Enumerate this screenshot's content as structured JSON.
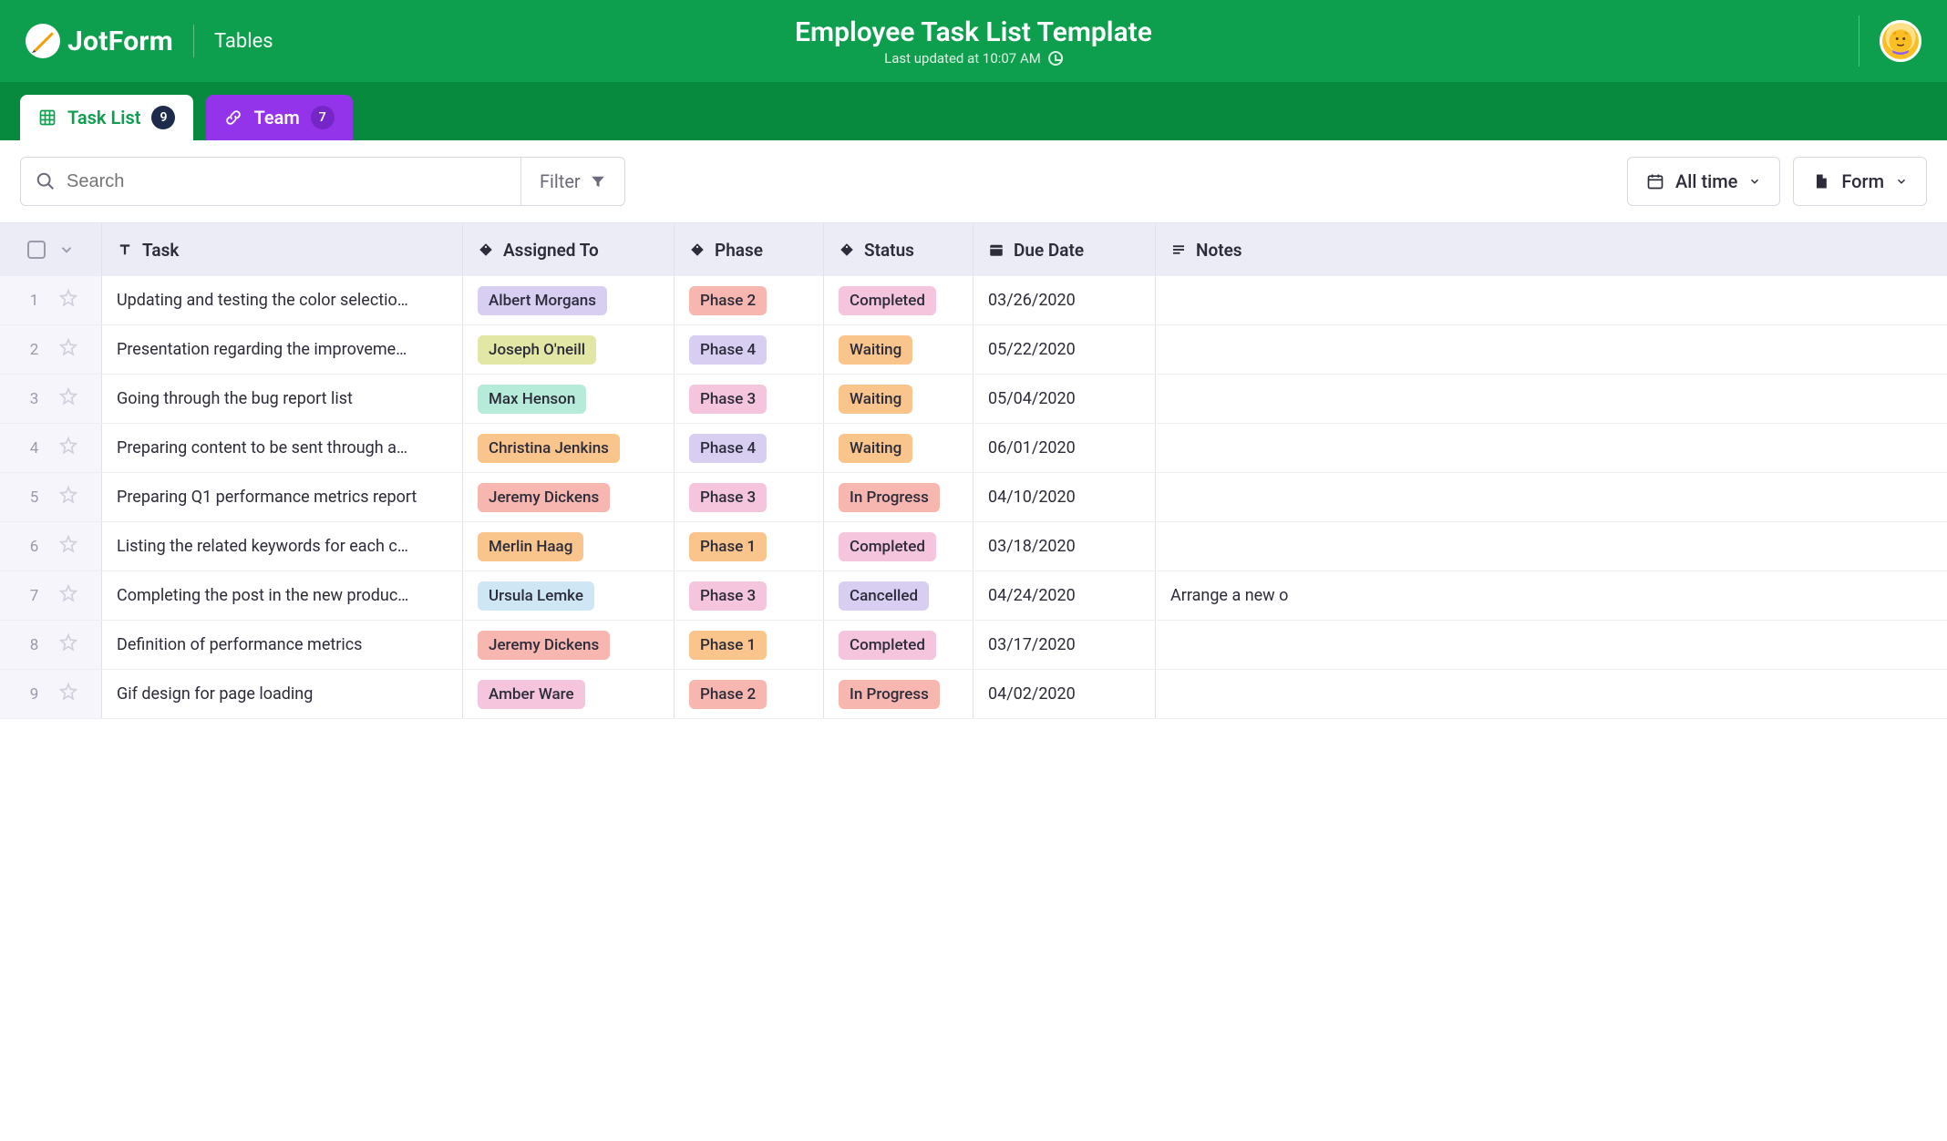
{
  "app": {
    "logo_text": "JotForm",
    "section_label": "Tables",
    "doc_title": "Employee Task List Template",
    "last_updated": "Last updated at 10:07 AM"
  },
  "tabs": {
    "task_list": {
      "label": "Task List",
      "count": "9"
    },
    "team": {
      "label": "Team",
      "count": "7"
    }
  },
  "toolbar": {
    "search_placeholder": "Search",
    "filter_label": "Filter",
    "alltime_label": "All time",
    "form_label": "Form"
  },
  "columns": {
    "task": "Task",
    "assigned": "Assigned To",
    "phase": "Phase",
    "status": "Status",
    "due": "Due Date",
    "notes": "Notes"
  },
  "tag_colors": {
    "assignee": {
      "Albert Morgans": "#d8cef2",
      "Joseph O'neill": "#e3e7a6",
      "Max Henson": "#b7ebd9",
      "Christina Jenkins": "#f9c58c",
      "Jeremy Dickens": "#f7b7b0",
      "Merlin Haag": "#f9c58c",
      "Ursula Lemke": "#cfe7f5",
      "Amber Ware": "#f5c4dd"
    },
    "phase": {
      "Phase 1": "#f9c58c",
      "Phase 2": "#f7b7b0",
      "Phase 3": "#f5c4dd",
      "Phase 4": "#d8cef2"
    },
    "status": {
      "Completed": "#f5c4dd",
      "Waiting": "#f9c58c",
      "In Progress": "#f7b7b0",
      "Cancelled": "#d8cef2"
    }
  },
  "rows": [
    {
      "n": "1",
      "task": "Updating and testing the color selectio…",
      "assignee": "Albert Morgans",
      "phase": "Phase 2",
      "status": "Completed",
      "due": "03/26/2020",
      "notes": ""
    },
    {
      "n": "2",
      "task": "Presentation regarding the improveme…",
      "assignee": "Joseph O'neill",
      "phase": "Phase 4",
      "status": "Waiting",
      "due": "05/22/2020",
      "notes": ""
    },
    {
      "n": "3",
      "task": "Going through the bug report list",
      "assignee": "Max Henson",
      "phase": "Phase 3",
      "status": "Waiting",
      "due": "05/04/2020",
      "notes": ""
    },
    {
      "n": "4",
      "task": "Preparing content to be sent through a…",
      "assignee": "Christina Jenkins",
      "phase": "Phase 4",
      "status": "Waiting",
      "due": "06/01/2020",
      "notes": ""
    },
    {
      "n": "5",
      "task": "Preparing Q1 performance metrics report",
      "assignee": "Jeremy Dickens",
      "phase": "Phase 3",
      "status": "In Progress",
      "due": "04/10/2020",
      "notes": ""
    },
    {
      "n": "6",
      "task": "Listing the related keywords for each c…",
      "assignee": "Merlin Haag",
      "phase": "Phase 1",
      "status": "Completed",
      "due": "03/18/2020",
      "notes": ""
    },
    {
      "n": "7",
      "task": "Completing the post in the new produc…",
      "assignee": "Ursula Lemke",
      "phase": "Phase 3",
      "status": "Cancelled",
      "due": "04/24/2020",
      "notes": "Arrange a new o"
    },
    {
      "n": "8",
      "task": "Definition of performance metrics",
      "assignee": "Jeremy Dickens",
      "phase": "Phase 1",
      "status": "Completed",
      "due": "03/17/2020",
      "notes": ""
    },
    {
      "n": "9",
      "task": "Gif design for page loading",
      "assignee": "Amber Ware",
      "phase": "Phase 2",
      "status": "In Progress",
      "due": "04/02/2020",
      "notes": ""
    }
  ]
}
